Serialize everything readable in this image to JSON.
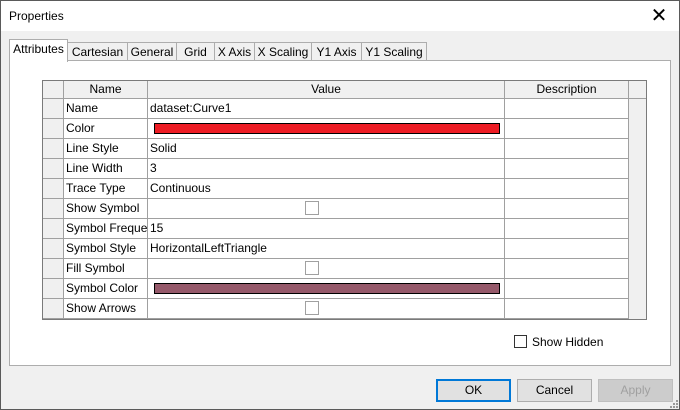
{
  "window": {
    "title": "Properties"
  },
  "tabs": [
    {
      "label": "Attributes",
      "active": true
    },
    {
      "label": "Cartesian"
    },
    {
      "label": "General"
    },
    {
      "label": "Grid"
    },
    {
      "label": "X Axis"
    },
    {
      "label": "X Scaling"
    },
    {
      "label": "Y1 Axis"
    },
    {
      "label": "Y1 Scaling"
    }
  ],
  "grid": {
    "headers": {
      "name": "Name",
      "value": "Value",
      "description": "Description"
    },
    "rows": [
      {
        "name": "Name",
        "value": "dataset:Curve1",
        "kind": "text"
      },
      {
        "name": "Color",
        "value": "",
        "kind": "color",
        "color": "#ed1c24"
      },
      {
        "name": "Line Style",
        "value": "Solid",
        "kind": "text"
      },
      {
        "name": "Line Width",
        "value": "3",
        "kind": "text"
      },
      {
        "name": "Trace Type",
        "value": "Continuous",
        "kind": "text"
      },
      {
        "name": "Show Symbol",
        "value": "",
        "kind": "checkbox",
        "checked": false
      },
      {
        "name": "Symbol Freque...",
        "value": "15",
        "kind": "text"
      },
      {
        "name": "Symbol Style",
        "value": "HorizontalLeftTriangle",
        "kind": "text"
      },
      {
        "name": "Fill Symbol",
        "value": "",
        "kind": "checkbox",
        "checked": false
      },
      {
        "name": "Symbol Color",
        "value": "",
        "kind": "color",
        "color": "#95596a"
      },
      {
        "name": "Show Arrows",
        "value": "",
        "kind": "checkbox",
        "checked": false
      }
    ]
  },
  "options": {
    "show_hidden_label": "Show Hidden",
    "show_hidden_checked": false
  },
  "buttons": {
    "ok": "OK",
    "cancel": "Cancel",
    "apply": "Apply"
  },
  "icons": {
    "close": "close-icon",
    "resize": "resize-grip-icon"
  }
}
